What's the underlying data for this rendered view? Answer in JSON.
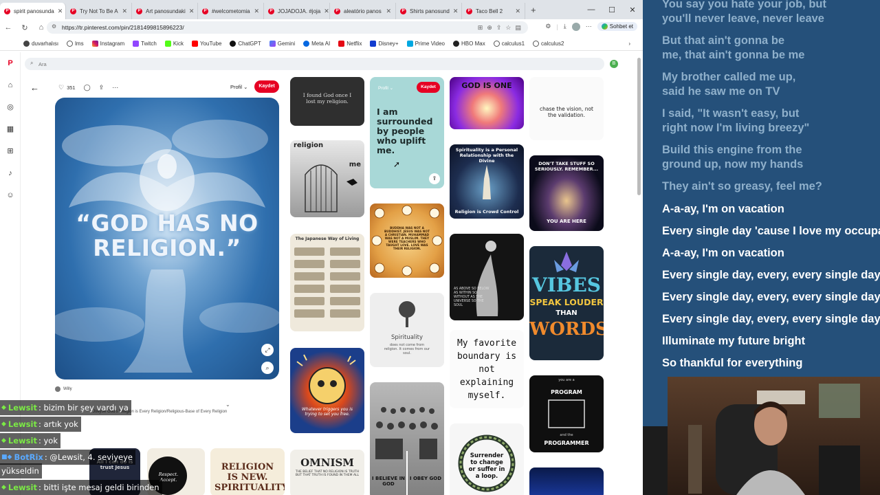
{
  "tabs": [
    {
      "label": "spirit panosunda",
      "active": true
    },
    {
      "label": "Try Not To Be A"
    },
    {
      "label": "Art panosundaki"
    },
    {
      "label": "#welcometomia"
    },
    {
      "label": "JOJADOJA. #joja"
    },
    {
      "label": "aleatório panos"
    },
    {
      "label": "Shirts panosund"
    },
    {
      "label": "Taco Bell 2"
    }
  ],
  "address": {
    "url": "https://tr.pinterest.com/pin/2181499815896223/",
    "chat_label": "Sohbet et"
  },
  "bookmarks": [
    "duvarhalısı",
    "lms",
    "Instagram",
    "Twitch",
    "Kick",
    "YouTube",
    "ChatGPT",
    "Gemini",
    "Meta AI",
    "Netflix",
    "Disney+",
    "Prime Video",
    "HBO Max",
    "calculus1",
    "calculus2"
  ],
  "search": {
    "placeholder": "Ara"
  },
  "avatar_letter": "B",
  "pin": {
    "likes": "351",
    "profile_label": "Profil",
    "save_label": "Kaydet",
    "hero_text": "“GOD HAS NO RELIGION.”",
    "author": "Willy",
    "comment": "Joeyoe God's Religion is Every Religion/Religious-Base of Every Religion"
  },
  "grid": {
    "col1": {
      "c1": "I found God once I lost my religion.",
      "c2a": "religion",
      "c2b": "me",
      "c3": "The Japanese Way of Living",
      "c4": "Whatever triggers you is trying to set you free.",
      "c5a": "OMNISM",
      "c5b": "THE BELIEF THAT NO RELIGION IS TRUTH BUT THAT TRUTH IS FOUND IN THEM ALL"
    },
    "col2": {
      "hover_profile": "Profil",
      "hover_save": "Kaydet",
      "c1": "I am surrounded by people who uplift me.",
      "c2": "BUDDHA WAS NOT A BUDDHIST. JESUS WAS NOT A CHRISTIAN. MUHAMMAD WAS NOT A MUSLIM. THEY WERE TEACHERS WHO TAUGHT LOVE. LOVE WAS THEIR RELIGION.",
      "c3a": "Spirituality",
      "c3b": "does not come from religion. It comes from our soul.",
      "c4a": "I BELIEVE IN GOD",
      "c4b": "I OBEY GOD"
    },
    "col3": {
      "c1": "GOD IS ONE",
      "c2a": "Spirituality is a Personal Relationship with the Divine",
      "c2b": "Religion is Crowd Control",
      "c3": "AS ABOVE SO BELOW AS WITHIN SO WITHOUT AS THE UNIVERSE SO THE SOUL",
      "c4": "My favorite boundary is not explaining myself.",
      "c5": "Surrender to change or suffer in a loop."
    },
    "col4": {
      "c1": "chase the vision, not the validation.",
      "c2a": "DON'T TAKE STUFF SO SERIOUSLY. REMEMBER...",
      "c2b": "YOU ARE HERE",
      "c3a": "VIBES",
      "c3b": "SPEAK LOUDER",
      "c3c": "THAN",
      "c3d": "WORDS",
      "c4a": "you are a",
      "c4b": "PROGRAM",
      "c4c": "and the",
      "c4d": "PROGRAMMER"
    },
    "bottom": {
      "b1": "All I can do is trust Jesus",
      "b2": "Respect. Accept.",
      "b3": "RELIGION IS NEW. SPIRITUALITY"
    }
  },
  "chat": [
    {
      "user": "Lewsit",
      "text": "bizim bir şey vardı ya"
    },
    {
      "user": "Lewsit",
      "text": "artık yok"
    },
    {
      "user": "Lewsit",
      "text": "yok"
    },
    {
      "user": "BotRix",
      "text": "@Lewsit, 4. seviyeye",
      "bot": true
    },
    {
      "user": "",
      "text": "yükseldin"
    },
    {
      "user": "Lewsit",
      "text": "bitti işte mesaj geldi birinden"
    }
  ],
  "lyrics": [
    {
      "text": "You say you hate your job, but",
      "current": false
    },
    {
      "text": "you'll never leave, never leave",
      "current": false
    },
    {
      "text": "But that ain't gonna be",
      "current": false
    },
    {
      "text": "me, that ain't gonna be me",
      "current": false
    },
    {
      "text": "My brother called me up,",
      "current": false
    },
    {
      "text": "said he saw me on TV",
      "current": false
    },
    {
      "text": "I said, \"It wasn't easy, but",
      "current": false
    },
    {
      "text": "right now I'm living breezy\"",
      "current": false
    },
    {
      "text": "Build this engine from the",
      "current": false
    },
    {
      "text": "ground up, now my hands",
      "current": false
    },
    {
      "text": "They ain't so greasy, feel me?",
      "current": false
    },
    {
      "text": "A-a-ay, I'm on vacation",
      "current": true
    },
    {
      "text": "Every single day 'cause I love my occupation",
      "current": true
    },
    {
      "text": "A-a-ay, I'm on vacation",
      "current": true
    },
    {
      "text": "Every single day, every, every single day",
      "current": true
    },
    {
      "text": "Every single day, every, every single day",
      "current": true
    },
    {
      "text": "Every single day, every, every single day",
      "current": true
    },
    {
      "text": "Illuminate my future bright",
      "current": true
    },
    {
      "text": "So thankful for everything",
      "current": true
    }
  ]
}
